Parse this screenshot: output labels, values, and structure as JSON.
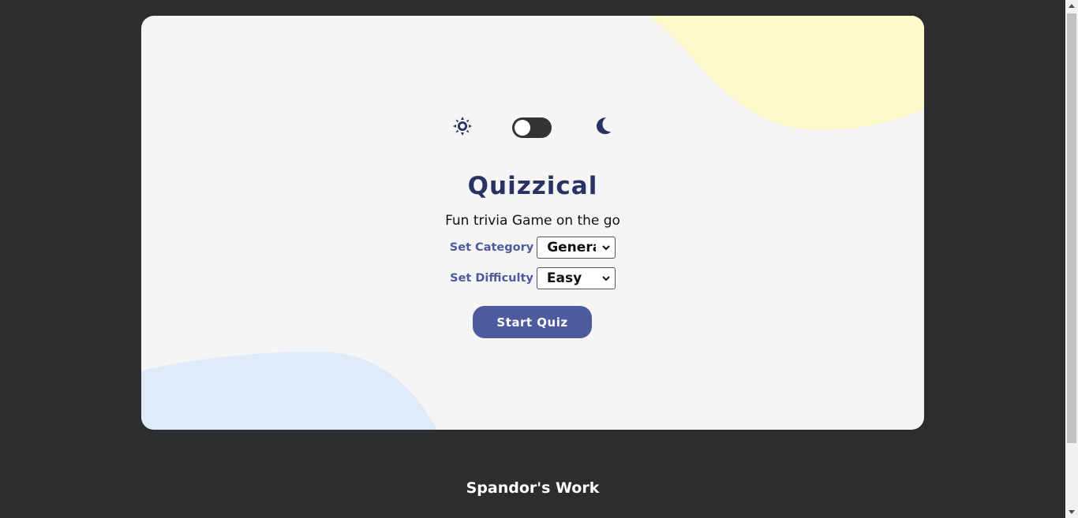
{
  "theme": {
    "light_icon": "sun-icon",
    "dark_icon": "moon-icon",
    "toggle_state": "off"
  },
  "main": {
    "title": "Quizzical",
    "subtitle": "Fun trivia Game on the go",
    "category": {
      "label": "Set Category",
      "selected": "General"
    },
    "difficulty": {
      "label": "Set Difficulty",
      "selected": "Easy"
    },
    "start_button": "Start Quiz"
  },
  "footer": {
    "text": "Spandor's Work"
  },
  "colors": {
    "page_background": "#2c2d2f",
    "card_background": "#f5f5f5",
    "title": "#293264",
    "accent": "#4d5b9e",
    "blob_yellow": "#fffacc",
    "blob_blue": "#deebf8"
  }
}
